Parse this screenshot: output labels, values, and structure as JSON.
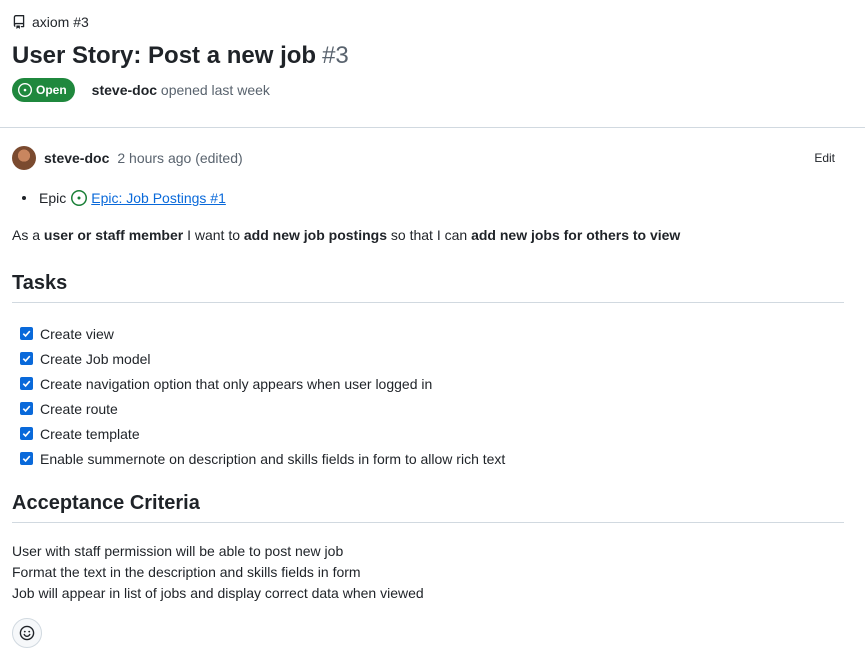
{
  "repo": {
    "ref": "axiom #3",
    "icon": "repo-icon"
  },
  "issue": {
    "title": "User Story: Post a new job",
    "number": "#3",
    "state": "Open",
    "opened_by": "steve-doc",
    "opened_when": "opened last week"
  },
  "comment": {
    "author": "steve-doc",
    "time": "2 hours ago (edited)",
    "edit_label": "Edit",
    "epic_label": "Epic",
    "epic_link": "Epic: Job Postings #1",
    "story": {
      "p1": "As a ",
      "b1": "user or staff member",
      "p2": " I want to ",
      "b2": "add new job postings",
      "p3": " so that I can ",
      "b3": "add new jobs for others to view"
    },
    "tasks_heading": "Tasks",
    "tasks": [
      {
        "label": "Create view",
        "checked": true
      },
      {
        "label": "Create Job model",
        "checked": true
      },
      {
        "label": "Create navigation option that only appears when user logged in",
        "checked": true
      },
      {
        "label": "Create route",
        "checked": true
      },
      {
        "label": "Create template",
        "checked": true
      },
      {
        "label": "Enable summernote on description and skills fields in form to allow rich text",
        "checked": true
      }
    ],
    "criteria_heading": "Acceptance Criteria",
    "criteria": [
      "User with staff permission will be able to post new job",
      "Format the text in the description and skills fields in form",
      "Job will appear in list of jobs and display correct data when viewed"
    ]
  },
  "colors": {
    "accent": "#0969da",
    "open": "#1f883d",
    "muted": "#59636e"
  }
}
